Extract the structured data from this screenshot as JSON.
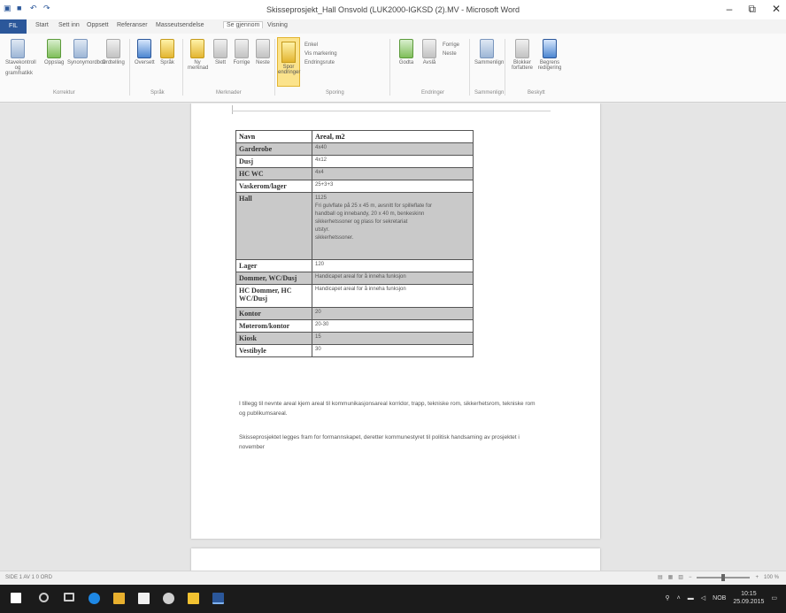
{
  "window": {
    "title": "Skisseprosjekt_Hall Onsvold (LUK2000-IGKSD (2).MV - Microsoft Word",
    "controls": [
      "–",
      "⧉",
      "✕"
    ]
  },
  "tabs": [
    {
      "label": "FIL"
    },
    {
      "label": "Start"
    },
    {
      "label": "Sett inn"
    },
    {
      "label": "Oppsett"
    },
    {
      "label": "Referanser"
    },
    {
      "label": "Masseutsendelse"
    },
    {
      "label": "Se gjennom"
    },
    {
      "label": "Visning"
    }
  ],
  "ribbon": {
    "buttons": [
      {
        "label": "Stavekontroll og grammatikk",
        "icon": "spellcheck-icon"
      },
      {
        "label": "Oppslag",
        "icon": "define-icon"
      },
      {
        "label": "Synonymordbok",
        "icon": "thesaurus-icon"
      },
      {
        "label": "Ordtelling",
        "icon": "word-count-icon"
      },
      {
        "label": "Oversett",
        "icon": "translate-icon"
      },
      {
        "label": "Språk",
        "icon": "language-icon"
      },
      {
        "label": "Ny merknad",
        "icon": "new-comment-icon"
      },
      {
        "label": "Slett",
        "icon": "delete-comment-icon"
      },
      {
        "label": "Forrige",
        "icon": "previous-comment-icon"
      },
      {
        "label": "Neste",
        "icon": "next-comment-icon"
      },
      {
        "label": "Spor endringer",
        "icon": "track-changes-icon"
      },
      {
        "label": "Godta",
        "icon": "accept-icon"
      },
      {
        "label": "Avslå",
        "icon": "reject-icon"
      },
      {
        "label": "Sammenlign",
        "icon": "compare-icon"
      },
      {
        "label": "Blokker forfattere",
        "icon": "block-authors-icon"
      },
      {
        "label": "Begrens redigering",
        "icon": "restrict-editing-icon"
      }
    ],
    "tracking_options": [
      "Enkel",
      "Vis markering",
      "Endringsrute"
    ],
    "change_options": [
      "Forrige",
      "Neste"
    ],
    "groups": [
      "Korrektur",
      "Språk",
      "Merknader",
      "Sporing",
      "Endringer",
      "Sammenlign",
      "Beskytt"
    ]
  },
  "table": {
    "headers": [
      "Navn",
      "Areal, m2"
    ],
    "rows": [
      {
        "name": "Garderobe",
        "area": "4x40",
        "shaded": true
      },
      {
        "name": "Dusj",
        "area": "4x12",
        "shaded": false
      },
      {
        "name": "HC WC",
        "area": "4x4",
        "shaded": true
      },
      {
        "name": "Vaskerom/lager",
        "area": "25+3+3",
        "shaded": false
      },
      {
        "name": "Hall",
        "area": "1125",
        "shaded": true,
        "lines": [
          "Fri gulvflate på 25 x 45 m, avsnitt for spilleflate for",
          "handball og innebandy, 20 x 40 m, benkeskinn",
          "sikkerhetssoner og plass for sekretariat",
          "utstyr.",
          "sikkerhetssoner."
        ]
      },
      {
        "name": "Lager",
        "area": "120",
        "shaded": false
      },
      {
        "name": "Dommer, WC/Dusj",
        "area": "Handicapet areal for å inneha funksjon",
        "shaded": true
      },
      {
        "name": "HC Dommer, HC WC/Dusj",
        "area": "Handicapet areal for å inneha funksjon",
        "shaded": false
      },
      {
        "name": "Kontor",
        "area": "20",
        "shaded": true
      },
      {
        "name": "Møterom/kontor",
        "area": "20-30",
        "shaded": false
      },
      {
        "name": "Kiosk",
        "area": "15",
        "shaded": true
      },
      {
        "name": "Vestibyle",
        "area": "30",
        "shaded": false
      }
    ]
  },
  "paragraphs": [
    "I tillegg til nevnte areal kjem areal til kommunikasjonsareal korridor, trapp, tekniske rom, sikkerhetsrom, tekniske rom og publikumsareal.",
    "Skisseprosjektet legges fram for formannskapet, deretter kommunestyret til politisk handsaming av prosjektet i november"
  ],
  "statusbar": {
    "left": "SIDE 1 AV 1   0 ORD",
    "zoom": "100 %"
  },
  "taskbar": {
    "time": "10:15",
    "date": "25.09.2015",
    "lang": "NOB"
  }
}
